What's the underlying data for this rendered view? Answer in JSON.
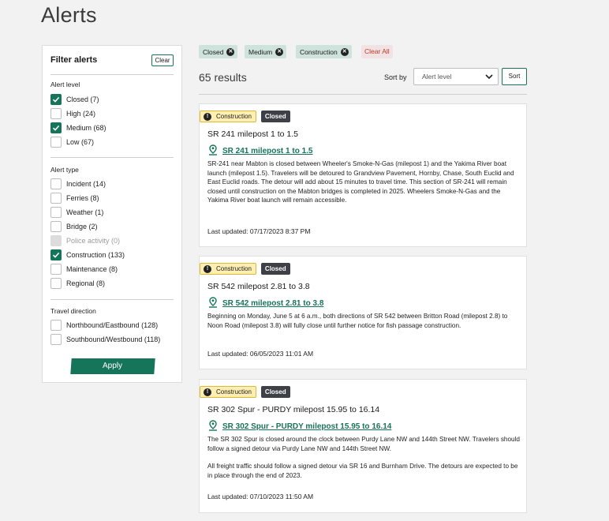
{
  "page": {
    "title": "Alerts"
  },
  "filters": {
    "heading": "Filter alerts",
    "clear_label": "Clear",
    "alert_level": {
      "title": "Alert level",
      "options": [
        {
          "label": "Closed (7)",
          "checked": true
        },
        {
          "label": "High (24)",
          "checked": false
        },
        {
          "label": "Medium (68)",
          "checked": true
        },
        {
          "label": "Low (67)",
          "checked": false
        }
      ]
    },
    "alert_type": {
      "title": "Alert type",
      "options": [
        {
          "label": "Incident (14)",
          "checked": false
        },
        {
          "label": "Ferries (8)",
          "checked": false
        },
        {
          "label": "Weather (1)",
          "checked": false
        },
        {
          "label": "Bridge (2)",
          "checked": false
        },
        {
          "label": "Police activity (0)",
          "checked": false,
          "disabled": true
        },
        {
          "label": "Construction (133)",
          "checked": true
        },
        {
          "label": "Maintenance (8)",
          "checked": false
        },
        {
          "label": "Regional (8)",
          "checked": false
        }
      ]
    },
    "travel_direction": {
      "title": "Travel direction",
      "options": [
        {
          "label": "Northbound/Eastbound (128)",
          "checked": false
        },
        {
          "label": "Southbound/Westbound (118)",
          "checked": false
        }
      ]
    },
    "apply_label": "Apply"
  },
  "active_filters": {
    "chips": [
      "Closed",
      "Medium",
      "Construction"
    ],
    "clear_all_label": "Clear All"
  },
  "results": {
    "count_label": "65 results",
    "sort_by_label": "Sort by",
    "sort_selected": "Alert level",
    "sort_button_label": "Sort"
  },
  "alerts": [
    {
      "type_badge": "Construction",
      "level_badge": "Closed",
      "title": "SR 241 milepost 1 to 1.5",
      "link": "SR 241 milepost 1 to 1.5",
      "description": [
        "SR-241 near Mabton is closed between Wheeler's Smoke-N-Gas (milepost 1) and the Yakima River boat launch (milepost 1.5). Travelers will be detoured to Grandview Pavement, Hornby, Chase, South Euclid and East Euclid roads. The detour will add about 15 minutes to travel time. This section of SR-241 will remain closed until construction on the Mabton bridges is completed in 2025. Wheelers Smoke-N-Gas and the Yakima River boat launch will remain accessible."
      ],
      "updated": "Last updated: 07/17/2023 8:37 PM"
    },
    {
      "type_badge": "Construction",
      "level_badge": "Closed",
      "title": "SR 542 milepost 2.81 to 3.8",
      "link": "SR 542 milepost 2.81 to 3.8",
      "description": [
        "Beginning on Monday, June 5 at 6 a.m., both directions of SR 542 between Britton Road (milepost 2.8) to Noon Road (milepost 3.8) will fully close until further notice for fish passage construction."
      ],
      "updated": "Last updated: 06/05/2023 11:01 AM"
    },
    {
      "type_badge": "Construction",
      "level_badge": "Closed",
      "title": "SR 302 Spur - PURDY milepost 15.95 to 16.14",
      "link": "SR 302 Spur - PURDY milepost 15.95 to 16.14",
      "description": [
        "The SR 302 Spur is closed around the clock between Purdy Lane NW and 144th Street NW. Travelers should follow a signed detour via Purdy Lane NW and 144th Street NW.",
        "All freight traffic should follow a signed detour via SR 16 and Burnham Drive. The detours are expected to be in place through the end of 2023."
      ],
      "updated": "Last updated: 07/10/2023 11:50 AM"
    }
  ],
  "colors": {
    "accent": "#16745a",
    "chip_bg": "#cfe3dd",
    "construction_badge": "#fdeeb2",
    "closed_badge": "#3e4047",
    "clear_all_text": "#c0392b"
  }
}
